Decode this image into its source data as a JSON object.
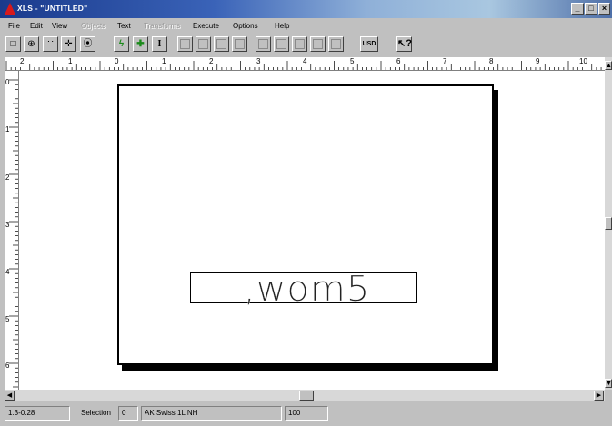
{
  "window": {
    "title": "XLS - \"UNTITLED\"",
    "controls": {
      "minimize": "_",
      "maximize": "□",
      "close": "×"
    }
  },
  "menu": [
    {
      "label": "File",
      "enabled": true
    },
    {
      "label": "Edit",
      "enabled": true
    },
    {
      "label": "View",
      "enabled": true
    },
    {
      "label": "Objects",
      "enabled": false
    },
    {
      "label": "Text",
      "enabled": true
    },
    {
      "label": "Transforms",
      "enabled": false
    },
    {
      "label": "Execute",
      "enabled": true
    },
    {
      "label": "Options",
      "enabled": true
    },
    {
      "label": "Help",
      "enabled": true
    }
  ],
  "toolbar": {
    "tools": [
      {
        "icon": "select-box-icon",
        "glyph": "□"
      },
      {
        "icon": "zoom-icon",
        "glyph": "⊕"
      },
      {
        "icon": "grid-icon",
        "glyph": "∷"
      },
      {
        "icon": "move-icon",
        "glyph": "✛"
      },
      {
        "icon": "target-icon",
        "glyph": "⦿"
      },
      {
        "icon": "lightning-icon",
        "glyph": "ϟ"
      },
      {
        "icon": "add-icon",
        "glyph": "✚"
      },
      {
        "icon": "text-cursor-icon",
        "glyph": "I"
      }
    ],
    "disabled_tools": [
      "object-tool-1-icon",
      "object-tool-2-icon",
      "object-tool-3-icon",
      "object-tool-4-icon",
      "transform-tool-1-icon",
      "transform-tool-2-icon",
      "transform-tool-3-icon",
      "transform-tool-4-icon",
      "transform-tool-5-icon"
    ],
    "units_label": "USD",
    "help_icon": "context-help-icon"
  },
  "ruler": {
    "horizontal_numbers": [
      "2",
      "1",
      "0",
      "1",
      "2",
      "3",
      "4",
      "5",
      "6",
      "7",
      "8",
      "9",
      "10"
    ],
    "vertical_numbers": [
      "0",
      "1",
      "2",
      "3",
      "4",
      "5",
      "6"
    ]
  },
  "canvas": {
    "text_object": ",wom5"
  },
  "status": {
    "coordinates": "1.3-0.28",
    "selection_label": "Selection",
    "selection_value": "0",
    "font": "AK Swiss 1L NH",
    "zoom": "100"
  }
}
